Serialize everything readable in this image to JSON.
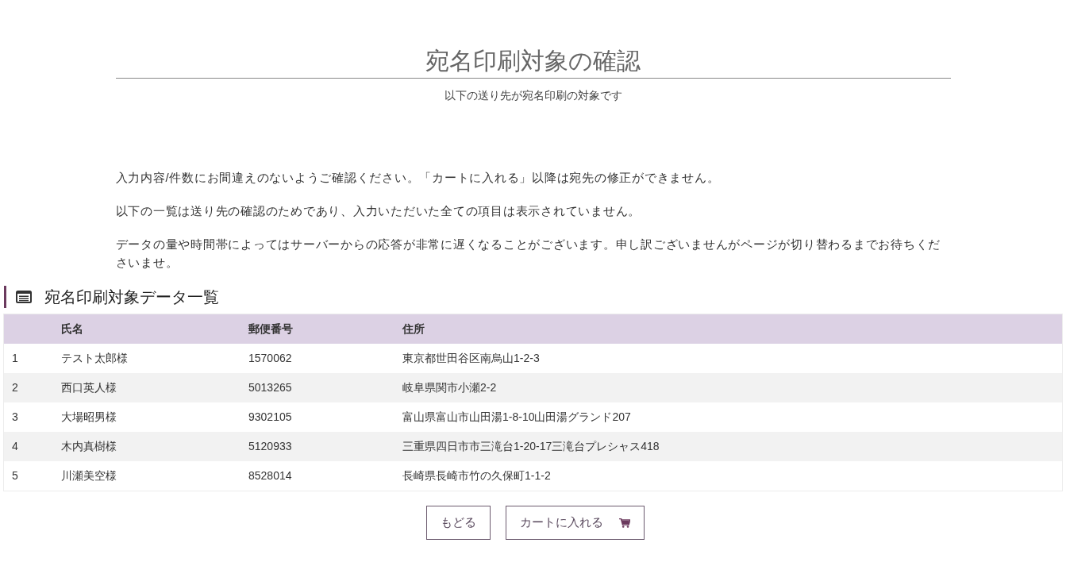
{
  "header": {
    "title": "宛名印刷対象の確認",
    "subtitle": "以下の送り先が宛名印刷の対象です"
  },
  "notes": [
    "入力内容/件数にお間違えのないようご確認ください。「カートに入れる」以降は宛先の修正ができません。",
    "以下の一覧は送り先の確認のためであり、入力いただいた全ての項目は表示されていません。",
    "データの量や時間帯によってはサーバーからの応答が非常に遅くなることがございます。申し訳ございませんがページが切り替わるまでお待ちくださいませ。"
  ],
  "section": {
    "title": "宛名印刷対象データ一覧"
  },
  "table": {
    "columns": [
      "氏名",
      "郵便番号",
      "住所"
    ],
    "rows": [
      {
        "number": "1",
        "name": "テスト太郎様",
        "postal": "1570062",
        "address": "東京都世田谷区南烏山1-2-3"
      },
      {
        "number": "2",
        "name": "西口英人様",
        "postal": "5013265",
        "address": "岐阜県関市小瀬2-2"
      },
      {
        "number": "3",
        "name": "大場昭男様",
        "postal": "9302105",
        "address": "富山県富山市山田湯1-8-10山田湯グランド207"
      },
      {
        "number": "4",
        "name": "木内真樹様",
        "postal": "5120933",
        "address": "三重県四日市市三滝台1-20-17三滝台プレシャス418"
      },
      {
        "number": "5",
        "name": "川瀬美空様",
        "postal": "8528014",
        "address": "長崎県長崎市竹の久保町1-1-2"
      }
    ]
  },
  "buttons": [
    {
      "label": "もどる",
      "kind": "back"
    },
    {
      "label": "カートに入れる",
      "kind": "cart"
    }
  ]
}
